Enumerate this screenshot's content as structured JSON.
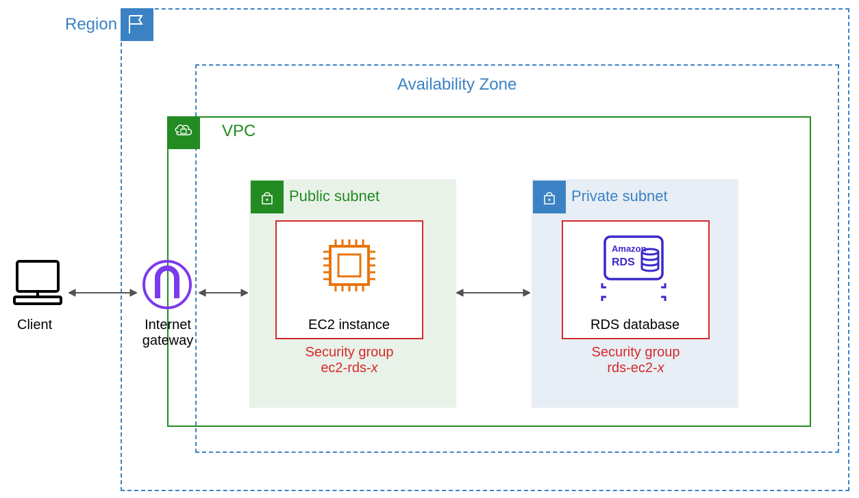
{
  "region": {
    "label": "Region"
  },
  "az": {
    "label": "Availability Zone"
  },
  "vpc": {
    "label": "VPC"
  },
  "public_subnet": {
    "label": "Public subnet"
  },
  "private_subnet": {
    "label": "Private subnet"
  },
  "ec2": {
    "label": "EC2 instance"
  },
  "rds": {
    "label": "RDS database",
    "box_label": "Amazon\nRDS"
  },
  "sg_public": {
    "title": "Security group",
    "name_prefix": "ec2-rds-",
    "name_suffix": "x"
  },
  "sg_private": {
    "title": "Security group",
    "name_prefix": "rds-ec2-",
    "name_suffix": "x"
  },
  "client": {
    "label": "Client"
  },
  "igw": {
    "label": "Internet gateway"
  }
}
